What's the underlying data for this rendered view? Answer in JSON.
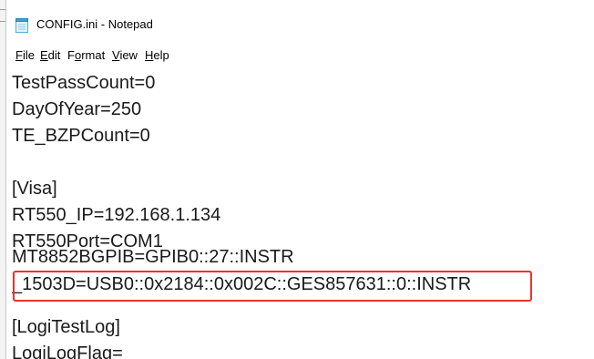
{
  "window": {
    "title": "CONFIG.ini - Notepad",
    "icon": "notepad-icon"
  },
  "menu": {
    "items": [
      {
        "id": "file",
        "mnemonic": "F",
        "rest": "ile"
      },
      {
        "id": "edit",
        "mnemonic": "E",
        "rest": "dit"
      },
      {
        "id": "format",
        "pre": "F",
        "mnemonic": "o",
        "rest": "rmat"
      },
      {
        "id": "view",
        "mnemonic": "V",
        "rest": "iew"
      },
      {
        "id": "help",
        "mnemonic": "H",
        "rest": "elp"
      }
    ]
  },
  "editor": {
    "lines": [
      "TestPassCount=0",
      "DayOfYear=250",
      "TE_BZPCount=0",
      "",
      "[Visa]",
      "RT550_IP=192.168.1.134",
      "RT550Port=COM1",
      "MT8852BGPIB=GPIB0::27::INSTR",
      "_1503D=USB0::0x2184::0x002C::GES857631::0::INSTR",
      "",
      "[LogiTestLog]",
      "LogiLogFlag="
    ],
    "highlighted_line_index": 8
  },
  "colors": {
    "highlight_border": "#e8352e",
    "text": "#1a1a1a"
  }
}
